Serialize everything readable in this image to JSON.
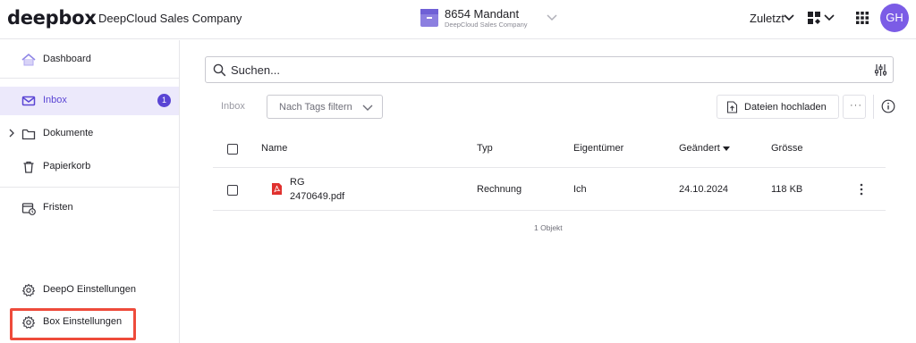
{
  "header": {
    "logo": "deepbox",
    "company": "DeepCloud Sales Company",
    "mandant_title": "8654 Mandant",
    "mandant_subtitle": "DeepCloud Sales Company",
    "recent_label": "Zuletzt",
    "avatar_initials": "GH",
    "accent": "#7b5ce6"
  },
  "sidebar": {
    "items": [
      {
        "label": "Dashboard",
        "icon": "home-icon"
      },
      {
        "label": "Inbox",
        "icon": "mail-icon",
        "badge": "1",
        "active": true
      },
      {
        "label": "Dokumente",
        "icon": "folder-icon"
      },
      {
        "label": "Papierkorb",
        "icon": "trash-icon"
      },
      {
        "label": "Fristen",
        "icon": "calendar-clock-icon"
      },
      {
        "label": "DeepO Einstellungen",
        "icon": "gear-icon"
      },
      {
        "label": "Box Einstellungen",
        "icon": "gear-icon",
        "highlighted": true
      }
    ]
  },
  "search": {
    "placeholder": "Suchen..."
  },
  "toolbar": {
    "breadcrumb": "Inbox",
    "tag_filter_label": "Nach Tags filtern",
    "upload_label": "Dateien hochladen",
    "more_label": "···"
  },
  "table": {
    "columns": [
      "Name",
      "Typ",
      "Eigentümer",
      "Geändert",
      "Grösse"
    ],
    "sorted_column": "Geändert",
    "rows": [
      {
        "name_line1": "RG",
        "name_line2": "2470649.pdf",
        "type": "Rechnung",
        "owner": "Ich",
        "modified": "24.10.2024",
        "size": "118 KB",
        "icon": "pdf-icon"
      }
    ],
    "count_label": "1 Objekt"
  },
  "colors": {
    "active_bg": "#ece9fb",
    "active_text": "#5a45d4",
    "highlight_border": "#ee4b3b",
    "pdf_red": "#e0312e"
  }
}
